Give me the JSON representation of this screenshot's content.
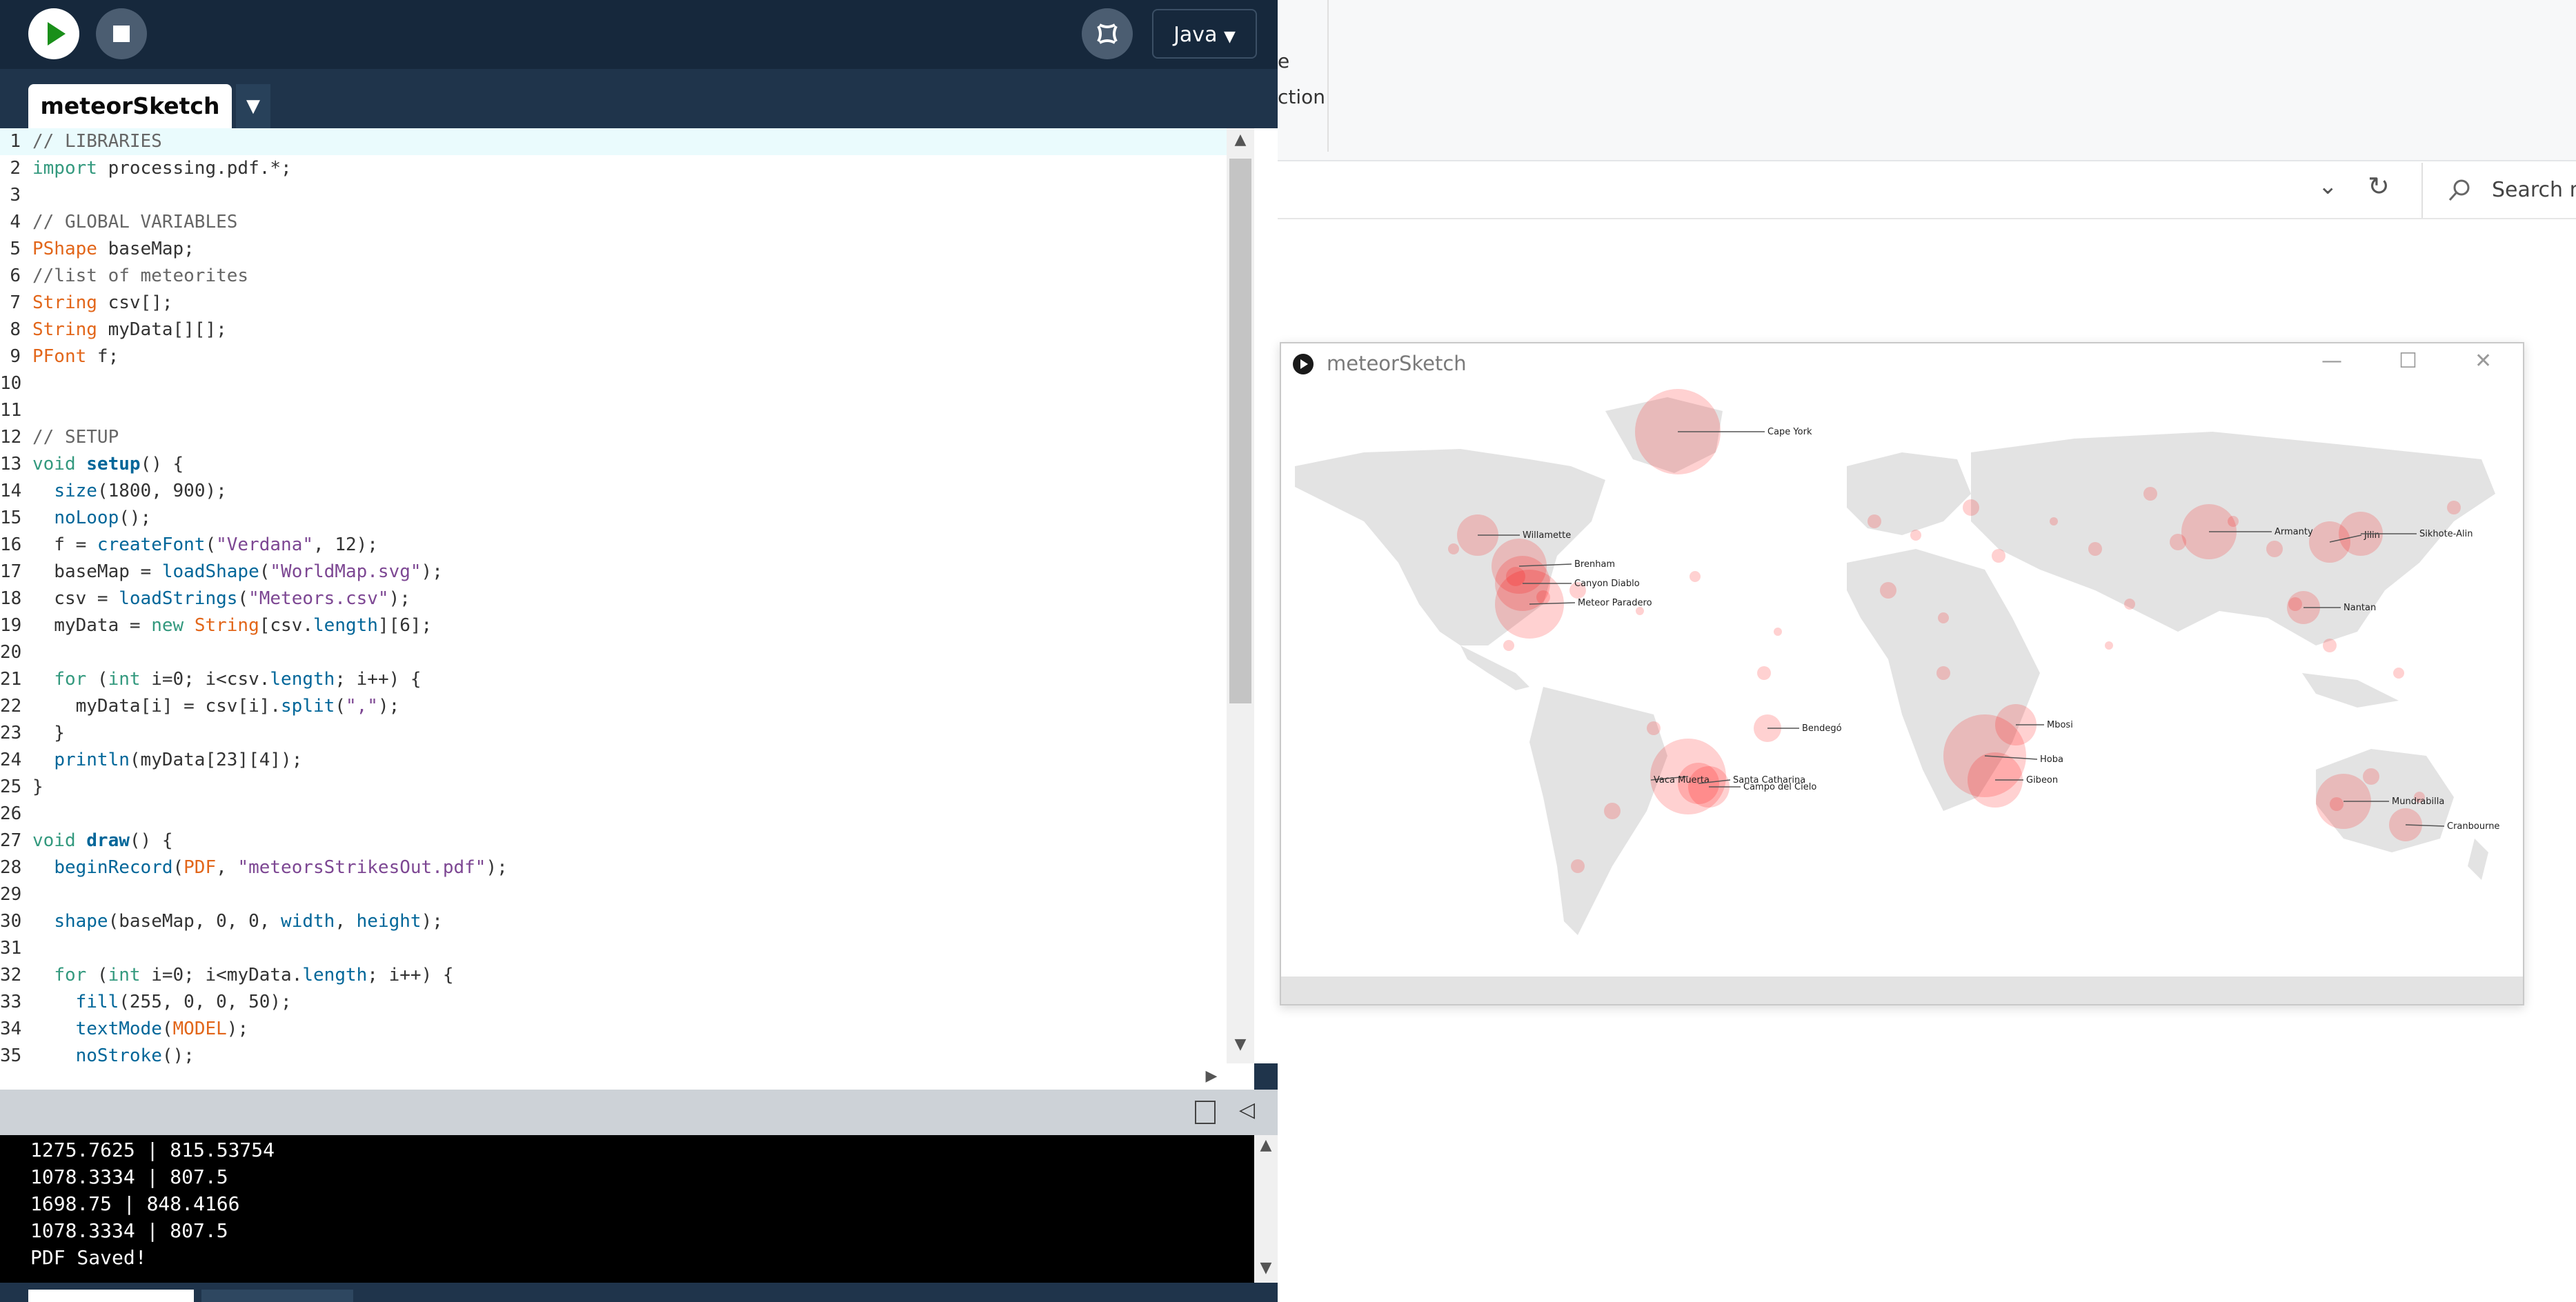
{
  "ide": {
    "run_label": "Run",
    "stop_label": "Stop",
    "debugger_label": "Debugger",
    "language": "Java",
    "language_arrow": "▼",
    "sketch_tab": "meteorSketch",
    "tab_menu_arrow": "▼",
    "code": [
      "// LIBRARIES",
      "import processing.pdf.*;",
      "",
      "// GLOBAL VARIABLES",
      "PShape baseMap;",
      "//list of meteorites",
      "String csv[];",
      "String myData[][];",
      "PFont f;",
      "",
      "",
      "// SETUP",
      "void setup() {",
      "  size(1800, 900);",
      "  noLoop();",
      "  f = createFont(\"Verdana\", 12);",
      "  baseMap = loadShape(\"WorldMap.svg\");",
      "  csv = loadStrings(\"Meteors.csv\");",
      "  myData = new String[csv.length][6];",
      "",
      "  for (int i=0; i<csv.length; i++) {",
      "    myData[i] = csv[i].split(\",\");",
      "  }",
      "  println(myData[23][4]);",
      "}",
      "",
      "void draw() {",
      "  beginRecord(PDF, \"meteorsStrikesOut.pdf\");",
      "",
      "  shape(baseMap, 0, 0, width, height);",
      "",
      "  for (int i=0; i<myData.length; i++) {",
      "    fill(255, 0, 0, 50);",
      "    textMode(MODEL);",
      "    noStroke();"
    ],
    "console": [
      "1275.7625 | 815.53754",
      "1078.3334 | 807.5",
      "1698.75 | 848.4166",
      "1078.3334 | 807.5",
      "PDF Saved!"
    ],
    "console_toggle": "◁",
    "scroll_up": "▲",
    "scroll_down": "▼",
    "scroll_right": "▶"
  },
  "background_window": {
    "ribbon_text_1": "e",
    "ribbon_text_2": "ction",
    "dropdown_arrow": "⌄",
    "refresh_icon": "↻",
    "search_placeholder": "Search m"
  },
  "sketch_window": {
    "title": "meteorSketch",
    "minimize": "—",
    "maximize": "☐",
    "close": "✕",
    "labels": [
      "Cape York",
      "Willamette",
      "Brenham",
      "Canyon Diablo",
      "Meteor Paradero",
      "Armanty",
      "Jilin",
      "Sikhote-Alin",
      "Nantan",
      "Bendegó",
      "Mbosi",
      "Hoba",
      "Gibeon",
      "Vaca Muerta",
      "Santa Catharina",
      "Campo del Cielo",
      "Mundrabilla",
      "Cranbourne"
    ]
  },
  "colors": {
    "ide_bg": "#1f344b",
    "ide_toolbar": "#16283c",
    "keyword": "#33997e",
    "type": "#e2661a",
    "string": "#7d4793",
    "comment": "#666666",
    "function": "#006699",
    "meteor_fill": "#ff000032",
    "land": "#e3e3e3"
  }
}
